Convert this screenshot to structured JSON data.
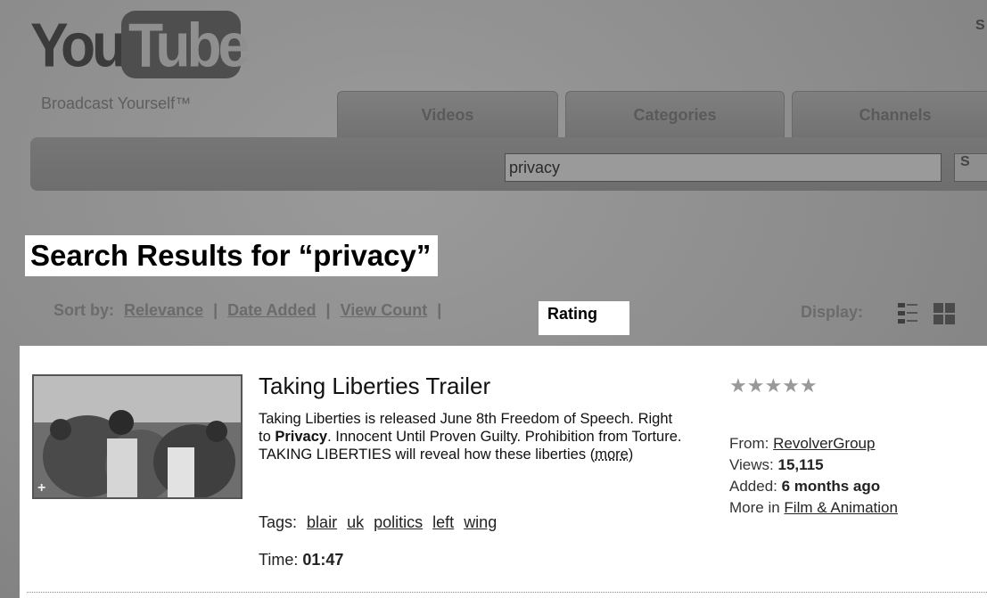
{
  "logo": {
    "you": "You",
    "tube": "Tube",
    "tagline": "Broadcast Yourself™"
  },
  "top_right_link": "S",
  "tabs": [
    {
      "label": "Videos"
    },
    {
      "label": "Categories"
    },
    {
      "label": "Channels"
    }
  ],
  "search": {
    "value": "privacy",
    "button_label": "S"
  },
  "results_heading": "Search Results for “privacy”",
  "sort": {
    "label": "Sort by:",
    "options": [
      "Relevance",
      "Date Added",
      "View Count",
      "Rating"
    ],
    "selected": "Rating",
    "separator": "|"
  },
  "display": {
    "label": "Display:"
  },
  "result": {
    "title": "Taking Liberties Trailer",
    "desc_part1": "Taking Liberties is released June 8th Freedom of Speech. Right to ",
    "desc_bold": "Privacy",
    "desc_part2": ". Innocent Until Proven Guilty. Prohibition from Torture. TAKING LIBERTIES will reveal how these liberties (",
    "desc_more": "more",
    "desc_close": ")",
    "tags_label": "Tags:",
    "tags": [
      "blair",
      "uk",
      "politics",
      "left",
      "wing"
    ],
    "time_label": "Time:",
    "time_value": "01:47",
    "rating_stars": "★★★★★",
    "from_label": "From:",
    "from_value": "RevolverGroup",
    "views_label": "Views:",
    "views_value": "15,115",
    "added_label": "Added:",
    "added_value": "6 months ago",
    "more_in_label": "More in",
    "more_in_value": "Film & Animation"
  },
  "colors": {
    "background": "#8a8a8a",
    "panel": "#ffffff",
    "text": "#111111"
  }
}
